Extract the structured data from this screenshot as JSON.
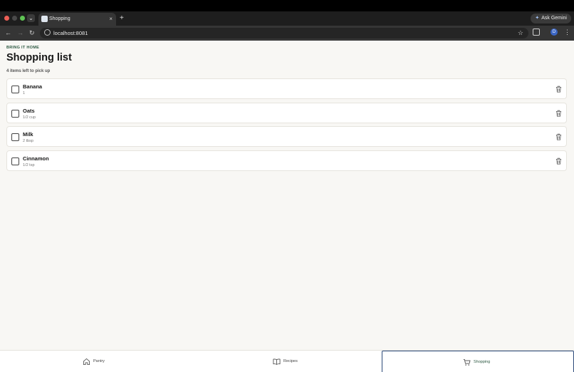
{
  "browser": {
    "tab_title": "Shopping",
    "tab_close": "×",
    "new_tab": "+",
    "tab_menu": "⌄",
    "ask_gemini": "Ask Gemini",
    "url": "localhost:8081",
    "profile_initial": "D",
    "icons": [
      "back-arrow-icon",
      "forward-arrow-icon",
      "reload-icon",
      "site-info-icon",
      "star-icon",
      "extensions-icon",
      "kebab-menu-icon"
    ]
  },
  "header": {
    "eyebrow": "BRING IT HOME",
    "title": "Shopping list",
    "subtitle": "4 items left to pick up"
  },
  "items": [
    {
      "name": "Banana",
      "qty": "1",
      "checked": false
    },
    {
      "name": "Oats",
      "qty": "1/2 cup",
      "checked": false
    },
    {
      "name": "Milk",
      "qty": "2 tbsp",
      "checked": false
    },
    {
      "name": "Cinnamon",
      "qty": "1/2 tsp",
      "checked": false
    }
  ],
  "bottom_nav": {
    "pantry": "Pantry",
    "recipes": "Recipes",
    "shopping": "Shopping",
    "active": "shopping"
  },
  "colors": {
    "accent": "#2e5a43",
    "background": "#f8f7f4",
    "active_tab_border": "#2c4a7a"
  }
}
